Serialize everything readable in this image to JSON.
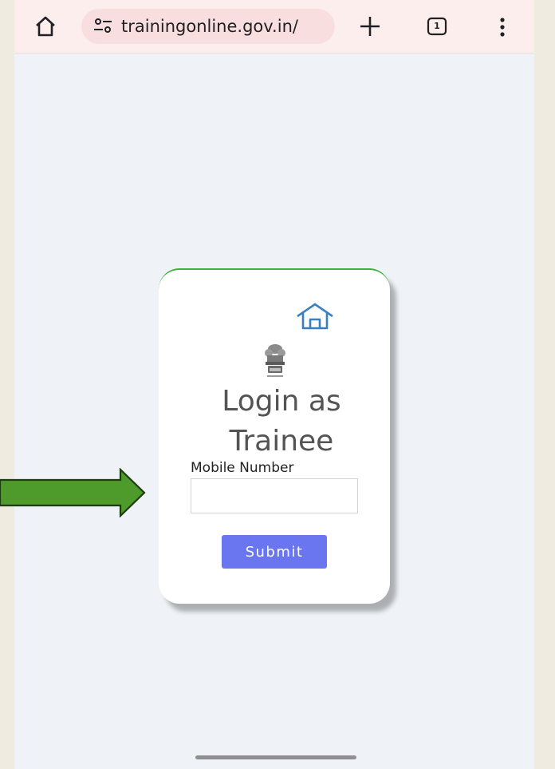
{
  "browser": {
    "url": "trainingonline.gov.in/",
    "tab_count": "1",
    "icons": {
      "home": "home-icon",
      "site_settings": "site-settings-icon",
      "new_tab": "plus-icon",
      "tabs": "tab-switcher-icon",
      "menu": "more-vertical-icon"
    }
  },
  "login": {
    "title": "Login as Trainee",
    "mobile_label": "Mobile Number",
    "mobile_value": "",
    "submit_label": "Submit"
  },
  "colors": {
    "card_top_border": "#3cb33c",
    "home_icon": "#3a7fbf",
    "submit_button": "#6a75f0",
    "annotation_arrow": "#4e9a2b",
    "browser_bar": "#fdeeee",
    "page_background": "#eff3f7"
  }
}
